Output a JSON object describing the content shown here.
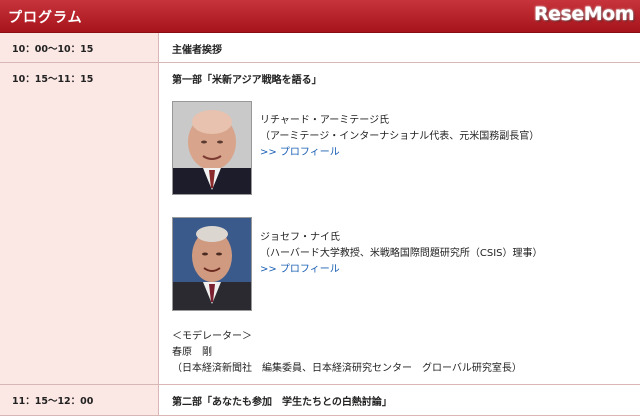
{
  "header": {
    "title": "プログラム",
    "logo": "ReseMom"
  },
  "rows": [
    {
      "time": "10：00〜10：15",
      "title": "主催者挨拶"
    },
    {
      "time": "10：15〜11：15",
      "title": "第一部「米新アジア戦略を語る」"
    },
    {
      "time": "11：15〜12：00",
      "title": "第二部「あなたも参加　学生たちとの白熱討論」"
    }
  ],
  "speakers": [
    {
      "name": "リチャード・アーミテージ氏",
      "affiliation": "（アーミテージ・インターナショナル代表、元米国務副長官）",
      "profile_link": ">> プロフィール"
    },
    {
      "name": "ジョセフ・ナイ氏",
      "affiliation": "（ハーバード大学教授、米戦略国際問題研究所（CSIS）理事）",
      "profile_link": ">> プロフィール"
    }
  ],
  "moderator": {
    "label": "＜モデレーター＞",
    "name": "春原　剛",
    "affiliation": "（日本経済新聞社　編集委員、日本経済研究センター　グローバル研究室長）"
  }
}
